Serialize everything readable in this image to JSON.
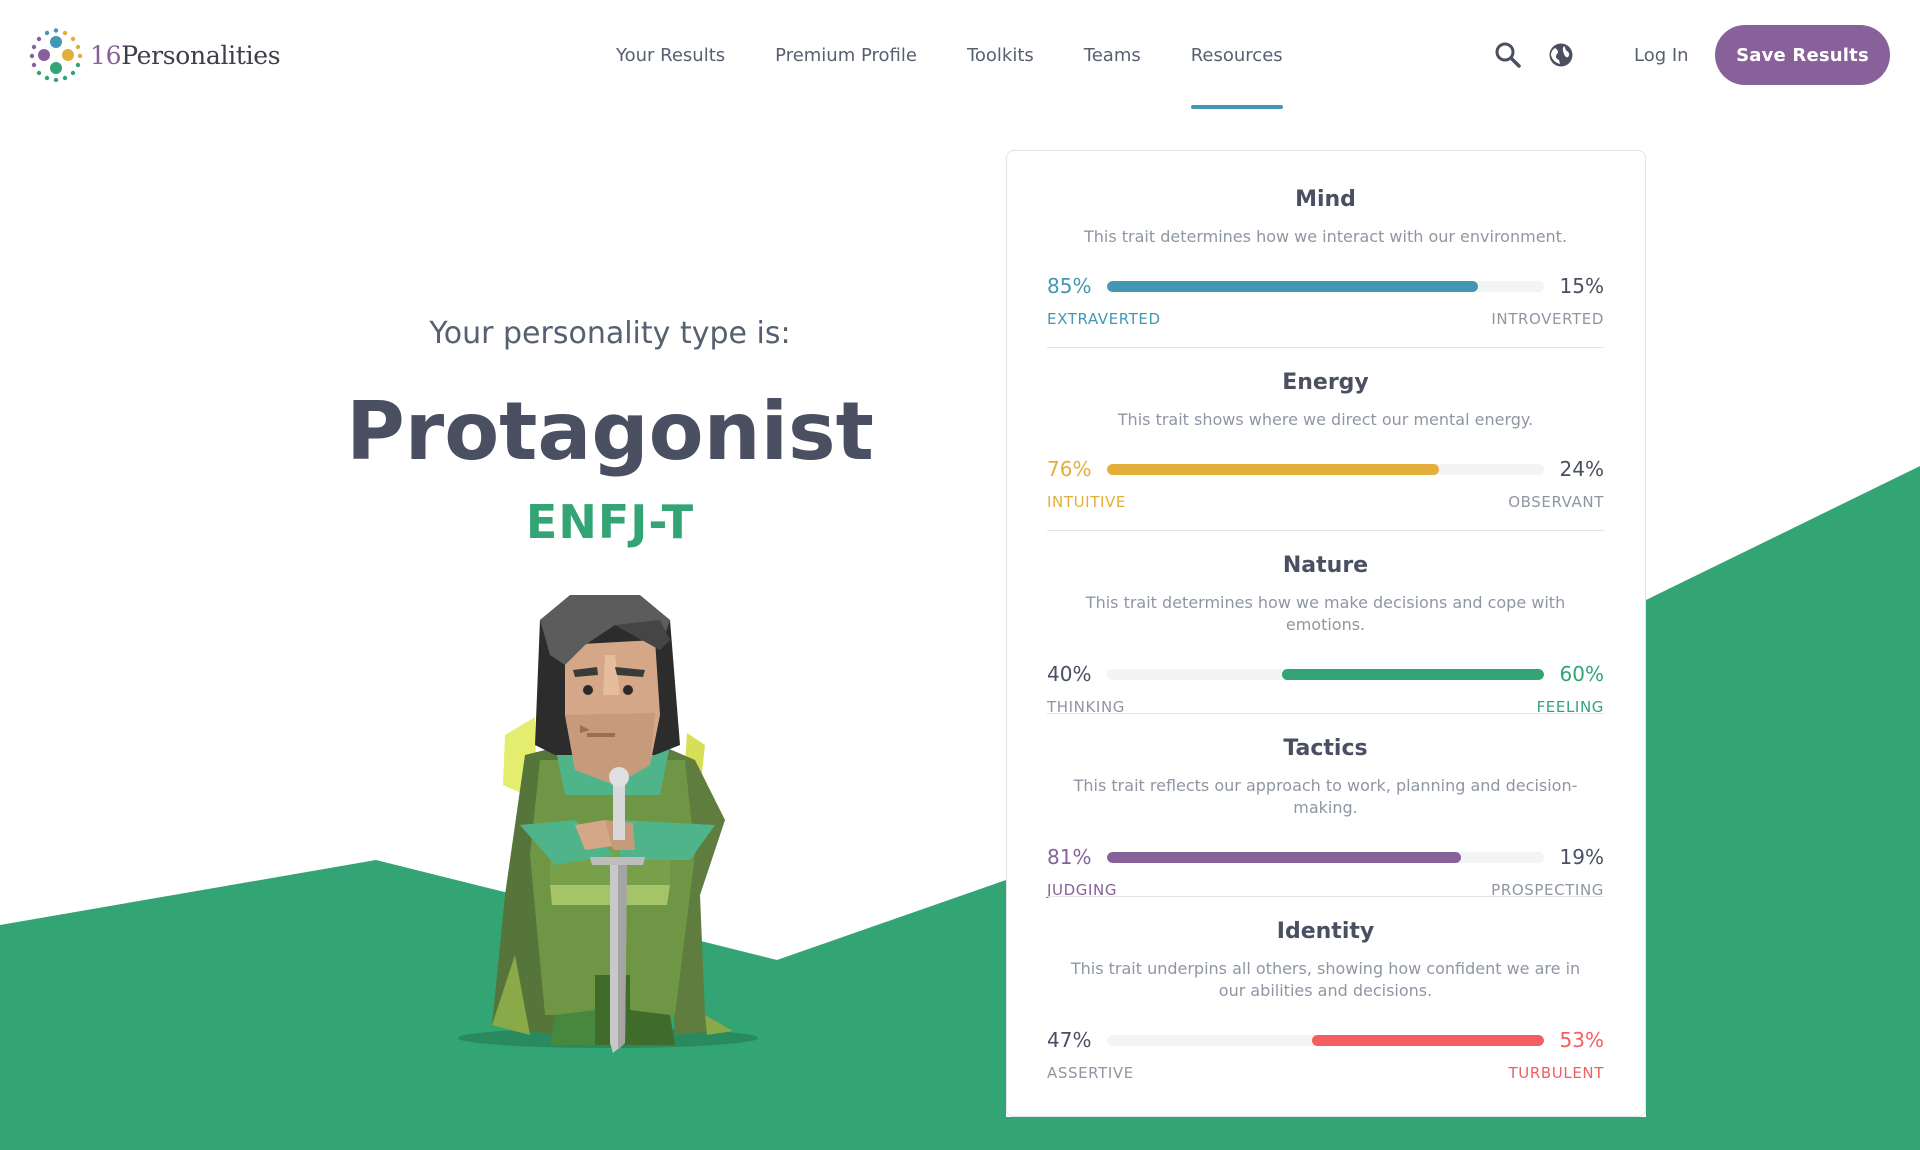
{
  "brand": {
    "name_num": "16",
    "name_text": "Personalities"
  },
  "nav": {
    "items": [
      {
        "label": "Your Results",
        "active": false
      },
      {
        "label": "Premium Profile",
        "active": false
      },
      {
        "label": "Toolkits",
        "active": false
      },
      {
        "label": "Teams",
        "active": false
      },
      {
        "label": "Resources",
        "active": true
      }
    ],
    "search_icon": "search-icon",
    "language_icon": "globe-icon",
    "login_label": "Log In",
    "save_label": "Save Results"
  },
  "hero": {
    "subtitle": "Your personality type is:",
    "type_name": "Protagonist",
    "type_code": "ENFJ-T"
  },
  "traits": [
    {
      "name": "Mind",
      "description": "This trait determines how we interact with our environment.",
      "left_pct": "85%",
      "right_pct": "15%",
      "left_label": "EXTRAVERTED",
      "right_label": "INTROVERTED",
      "dominant": "left",
      "value": 0.85,
      "color": "#4298b4"
    },
    {
      "name": "Energy",
      "description": "This trait shows where we direct our mental energy.",
      "left_pct": "76%",
      "right_pct": "24%",
      "left_label": "INTUITIVE",
      "right_label": "OBSERVANT",
      "dominant": "left",
      "value": 0.76,
      "color": "#e4ae3a"
    },
    {
      "name": "Nature",
      "description": "This trait determines how we make decisions and cope with emotions.",
      "left_pct": "40%",
      "right_pct": "60%",
      "left_label": "THINKING",
      "right_label": "FEELING",
      "dominant": "right",
      "value": 0.6,
      "color": "#33a474"
    },
    {
      "name": "Tactics",
      "description": "This trait reflects our approach to work, planning and decision-making.",
      "left_pct": "81%",
      "right_pct": "19%",
      "left_label": "JUDGING",
      "right_label": "PROSPECTING",
      "dominant": "left",
      "value": 0.81,
      "color": "#88619a"
    },
    {
      "name": "Identity",
      "description": "This trait underpins all others, showing how confident we are in our abilities and decisions.",
      "left_pct": "47%",
      "right_pct": "53%",
      "left_label": "ASSERTIVE",
      "right_label": "TURBULENT",
      "dominant": "right",
      "value": 0.53,
      "color": "#f25e62"
    }
  ],
  "colors": {
    "accent_purple": "#88619a",
    "brand_green": "#33a474",
    "neutral_text": "#4a4f62",
    "muted_label": "#8f96a3"
  }
}
